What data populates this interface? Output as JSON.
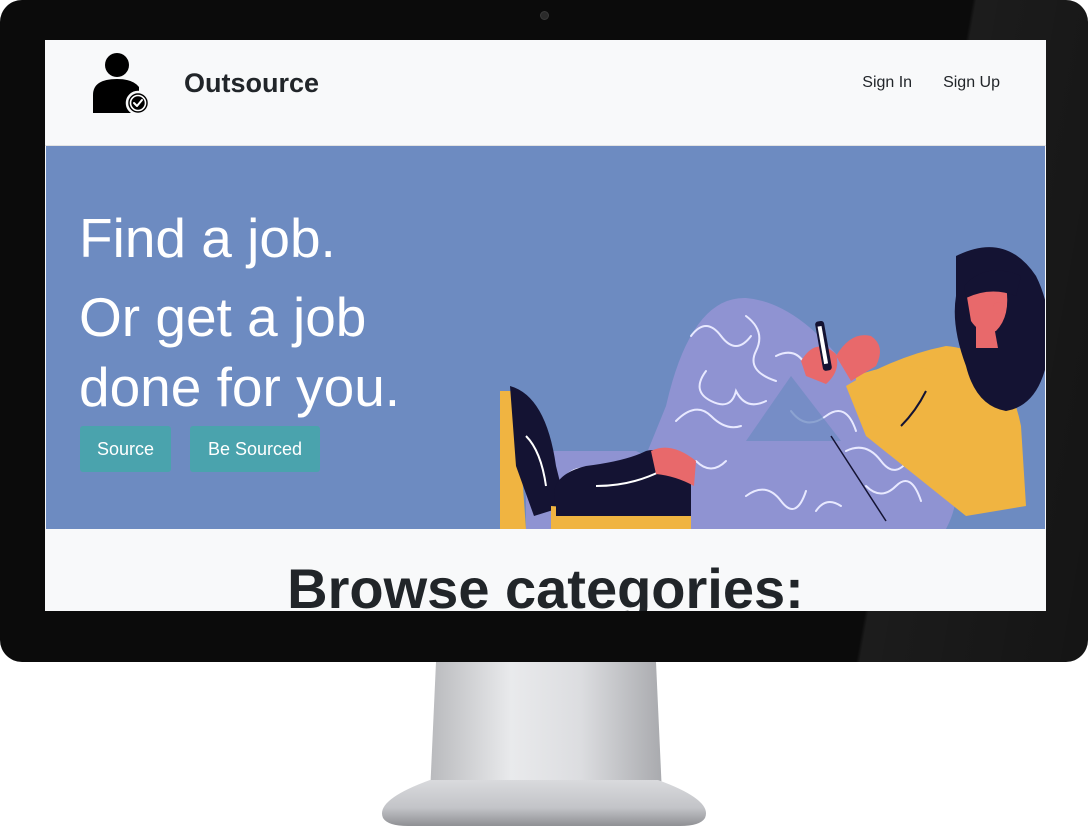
{
  "nav": {
    "brand": "Outsource",
    "links": [
      "Sign In",
      "Sign Up"
    ]
  },
  "hero": {
    "headline": [
      "Find a job.",
      "Or get a job",
      "done for you."
    ],
    "buttons": [
      "Source",
      "Be Sourced"
    ]
  },
  "browse": {
    "title": "Browse categories:"
  },
  "colors": {
    "hero_bg": "#6d8bc1",
    "button_bg": "#4aa3ad",
    "navbar_bg": "#f8f9fa",
    "text_dark": "#212529"
  },
  "icons": {
    "brand": "user-check-icon"
  }
}
